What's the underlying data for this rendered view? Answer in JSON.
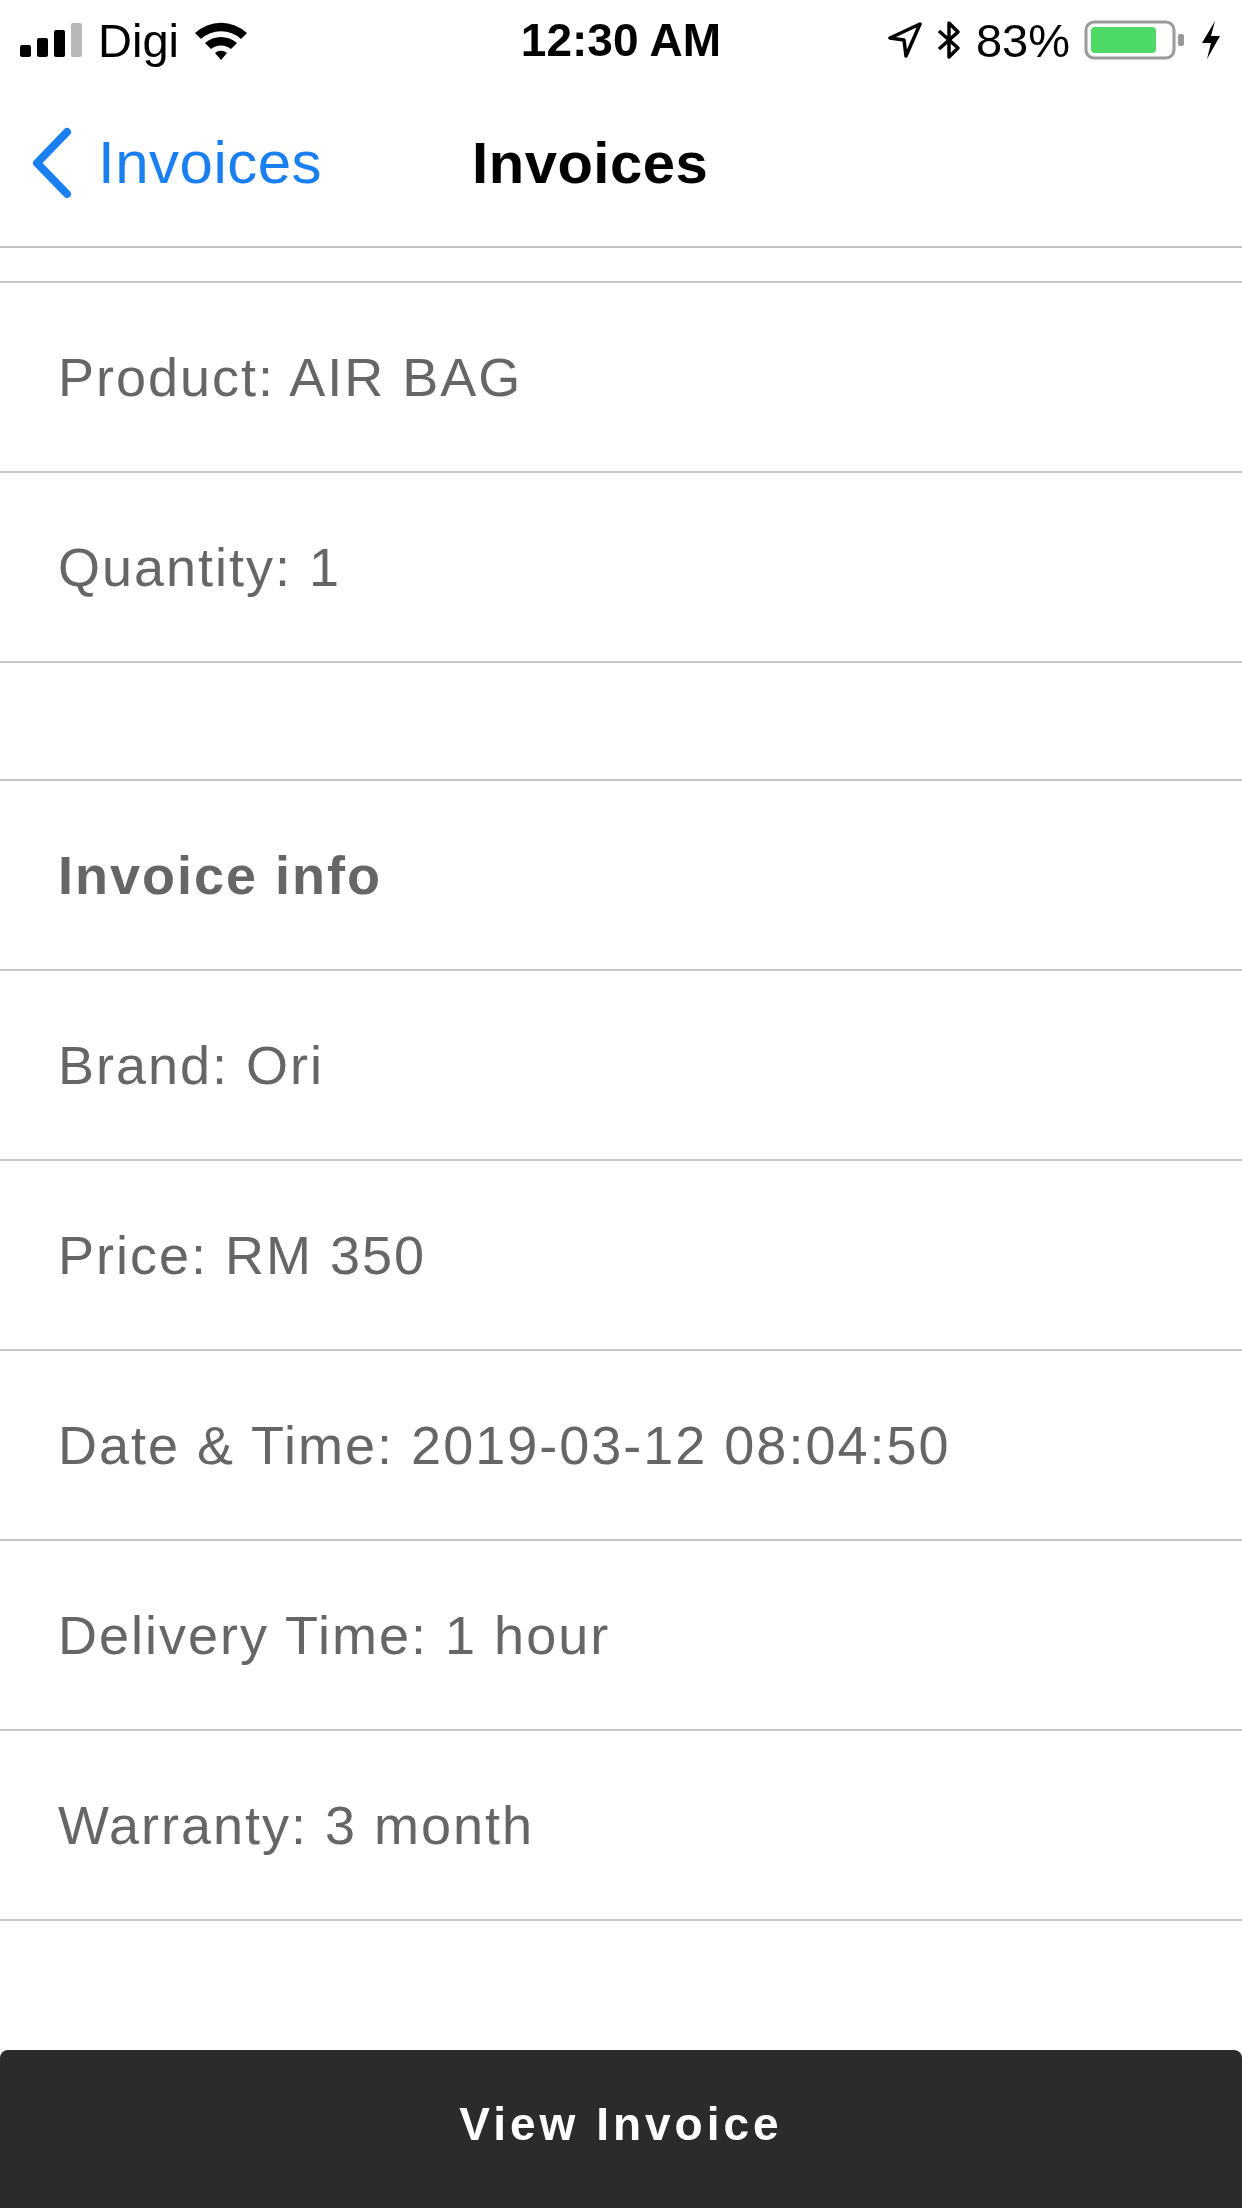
{
  "status_bar": {
    "carrier": "Digi",
    "time": "12:30 AM",
    "battery": "83%"
  },
  "nav_bar": {
    "back_label": "Invoices",
    "title": "Invoices"
  },
  "rows": [
    {
      "kind": "field",
      "text": "Product: AIR BAG"
    },
    {
      "kind": "field",
      "text": "Quantity: 1"
    },
    {
      "kind": "spacer"
    },
    {
      "kind": "header",
      "text": "Invoice info"
    },
    {
      "kind": "field",
      "text": "Brand: Ori"
    },
    {
      "kind": "field",
      "text": "Price: RM 350"
    },
    {
      "kind": "field",
      "text": "Date & Time: 2019-03-12 08:04:50"
    },
    {
      "kind": "field",
      "text": "Delivery Time: 1 hour"
    },
    {
      "kind": "field",
      "text": "Warranty: 3 month"
    }
  ],
  "button": {
    "label": "View Invoice"
  }
}
